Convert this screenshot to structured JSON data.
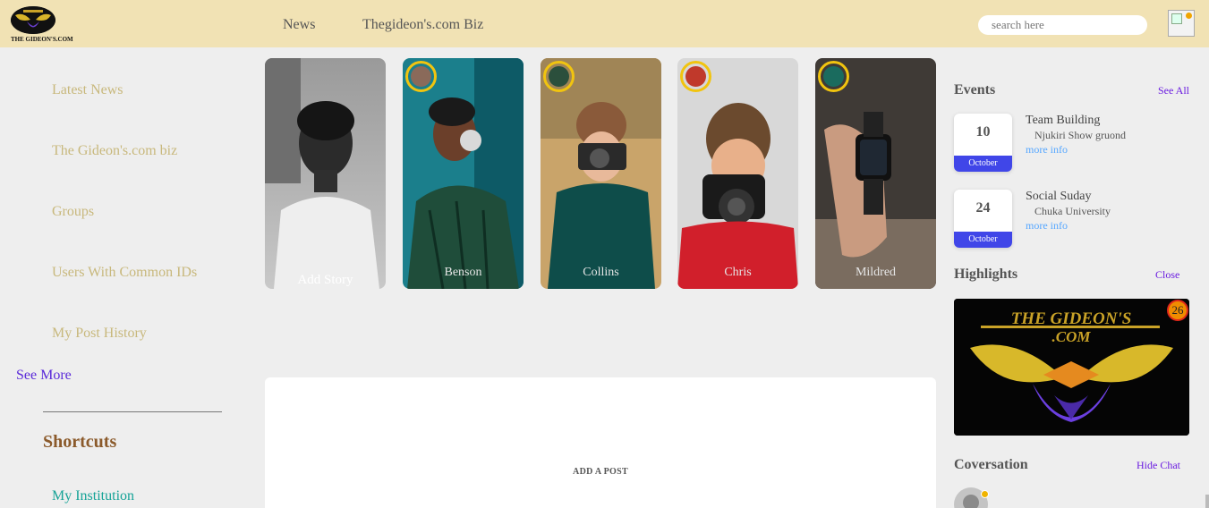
{
  "header": {
    "logo_name": "THE GIDEON'S.COM",
    "nav": [
      "News",
      "Thegideon's.com Biz"
    ],
    "search_placeholder": "search here"
  },
  "sidebar": {
    "items": [
      "Latest News",
      "The Gideon's.com biz",
      "Groups",
      "Users With Common IDs",
      "My Post History"
    ],
    "see_more": "See More",
    "shortcuts_title": "Shortcuts",
    "shortcuts": [
      "My Institution"
    ]
  },
  "stories": [
    {
      "name": "Add Story",
      "kind": "add"
    },
    {
      "name": "Benson",
      "kind": "user"
    },
    {
      "name": "Collins",
      "kind": "user"
    },
    {
      "name": "Chris",
      "kind": "user"
    },
    {
      "name": "Mildred",
      "kind": "user"
    }
  ],
  "post": {
    "label": "ADD A POST"
  },
  "events": {
    "title": "Events",
    "see_all": "See All",
    "list": [
      {
        "day": "10",
        "month": "October",
        "title": "Team Building",
        "place": "Njukiri Show gruond",
        "more": "more info"
      },
      {
        "day": "24",
        "month": "October",
        "title": "Social Suday",
        "place": "Chuka University",
        "more": "more info"
      }
    ]
  },
  "highlights": {
    "title": "Highlights",
    "close": "Close",
    "badge": "26",
    "banner_line1": "THE GIDEON'S",
    "banner_line2": ".COM"
  },
  "conversation": {
    "title": "Coversation",
    "hide": "Hide Chat"
  },
  "colors": {
    "header_bg": "#f1e2b4",
    "sidebar_link": "#c8b87c",
    "accent_purple": "#6a1be0",
    "event_month": "#4046e8",
    "story_ring": "#f1c40f",
    "online_dot": "#f0b400"
  }
}
